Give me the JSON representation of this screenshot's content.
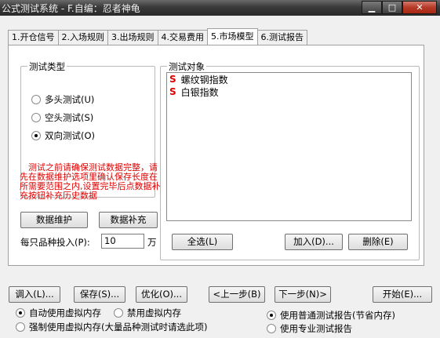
{
  "window": {
    "title": "公式测试系统 - F.自编：忍者神龟",
    "minimize_glyph": "▁",
    "maximize_glyph": "□",
    "close_glyph": "✕"
  },
  "tabs": [
    {
      "label": "1.开仓信号"
    },
    {
      "label": "2.入场规则"
    },
    {
      "label": "3.出场规则"
    },
    {
      "label": "4.交易费用"
    },
    {
      "label": "5.市场模型"
    },
    {
      "label": "6.测试报告"
    }
  ],
  "active_tab": 4,
  "test_type": {
    "title": "测试类型",
    "options": [
      {
        "label": "多头测试(U)",
        "checked": false
      },
      {
        "label": "空头测试(S)",
        "checked": false
      },
      {
        "label": "双向测试(O)",
        "checked": true
      }
    ]
  },
  "warning_text": "　测试之前请确保测试数据完整，请先在数据维护选项里确认保存长度在所需要范围之内,设置完毕后点数据补充按钮补充历史数据",
  "buttons": {
    "data_maintain": "数据维护",
    "data_supplement": "数据补充",
    "select_all": "全选(L)",
    "add": "加入(D)...",
    "delete": "删除(E)",
    "load": "调入(L)...",
    "save": "保存(S)...",
    "optimize": "优化(O)...",
    "prev": "<上一步(B)",
    "next": "下一步(N)>",
    "start": "开始(E)..."
  },
  "investment": {
    "label": "每只品种投入(P):",
    "value": "10",
    "unit": "万"
  },
  "test_objects": {
    "title": "测试对象",
    "items": [
      {
        "mark": "S",
        "name": "螺纹钢指数"
      },
      {
        "mark": "S",
        "name": "白银指数"
      }
    ]
  },
  "memory_options": [
    {
      "label": "自动使用虚拟内存",
      "checked": true
    },
    {
      "label": "禁用虚拟内存",
      "checked": false
    },
    {
      "label": "强制使用虚拟内存(大量品种测试时请选此项)",
      "checked": false
    }
  ],
  "report_options": [
    {
      "label": "使用普通测试报告(节省内存)",
      "checked": true
    },
    {
      "label": "使用专业测试报告",
      "checked": false
    }
  ]
}
